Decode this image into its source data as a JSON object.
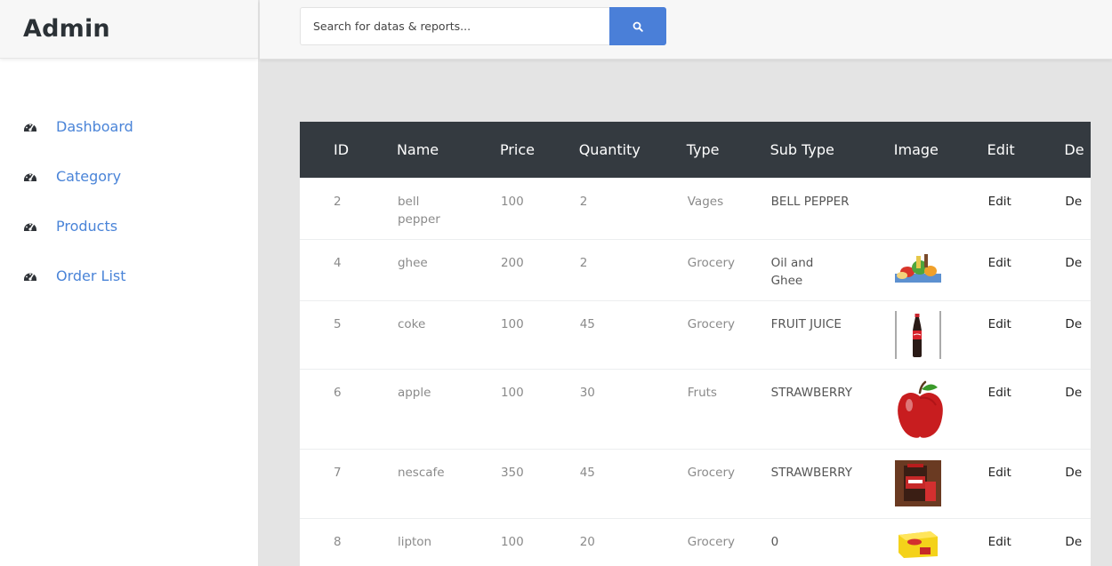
{
  "sidebar": {
    "brand": "Admin",
    "items": [
      {
        "label": "Dashboard",
        "icon": "dashboard-icon"
      },
      {
        "label": "Category",
        "icon": "dashboard-icon"
      },
      {
        "label": "Products",
        "icon": "dashboard-icon"
      },
      {
        "label": "Order List",
        "icon": "dashboard-icon"
      }
    ]
  },
  "topbar": {
    "search_placeholder": "Search for datas & reports...",
    "search_icon": "search-icon"
  },
  "colors": {
    "accent": "#4a7fd8",
    "nav_text": "#4a84d8",
    "table_header": "#343a40"
  },
  "table": {
    "headers": [
      "ID",
      "Name",
      "Price",
      "Quantity",
      "Type",
      "Sub Type",
      "Image",
      "Edit",
      "De"
    ],
    "rows": [
      {
        "id": "2",
        "name": "bell pepper",
        "price": "100",
        "quantity": "2",
        "type": "Vages",
        "subtype": "BELL PEPPER",
        "image": "none",
        "edit": "Edit",
        "delete": "De"
      },
      {
        "id": "4",
        "name": "ghee",
        "price": "200",
        "quantity": "2",
        "type": "Grocery",
        "subtype": "Oil and Ghee",
        "image": "groceries",
        "edit": "Edit",
        "delete": "De"
      },
      {
        "id": "5",
        "name": "coke",
        "price": "100",
        "quantity": "45",
        "type": "Grocery",
        "subtype": "FRUIT JUICE",
        "image": "coke-bottle",
        "edit": "Edit",
        "delete": "De"
      },
      {
        "id": "6",
        "name": "apple",
        "price": "100",
        "quantity": "30",
        "type": "Fruts",
        "subtype": "STRAWBERRY",
        "image": "apple",
        "edit": "Edit",
        "delete": "De"
      },
      {
        "id": "7",
        "name": "nescafe",
        "price": "350",
        "quantity": "45",
        "type": "Grocery",
        "subtype": "STRAWBERRY",
        "image": "nescafe-jar",
        "edit": "Edit",
        "delete": "De"
      },
      {
        "id": "8",
        "name": "lipton",
        "price": "100",
        "quantity": "20",
        "type": "Grocery",
        "subtype": "0",
        "image": "lipton-box",
        "edit": "Edit",
        "delete": "De"
      }
    ]
  }
}
